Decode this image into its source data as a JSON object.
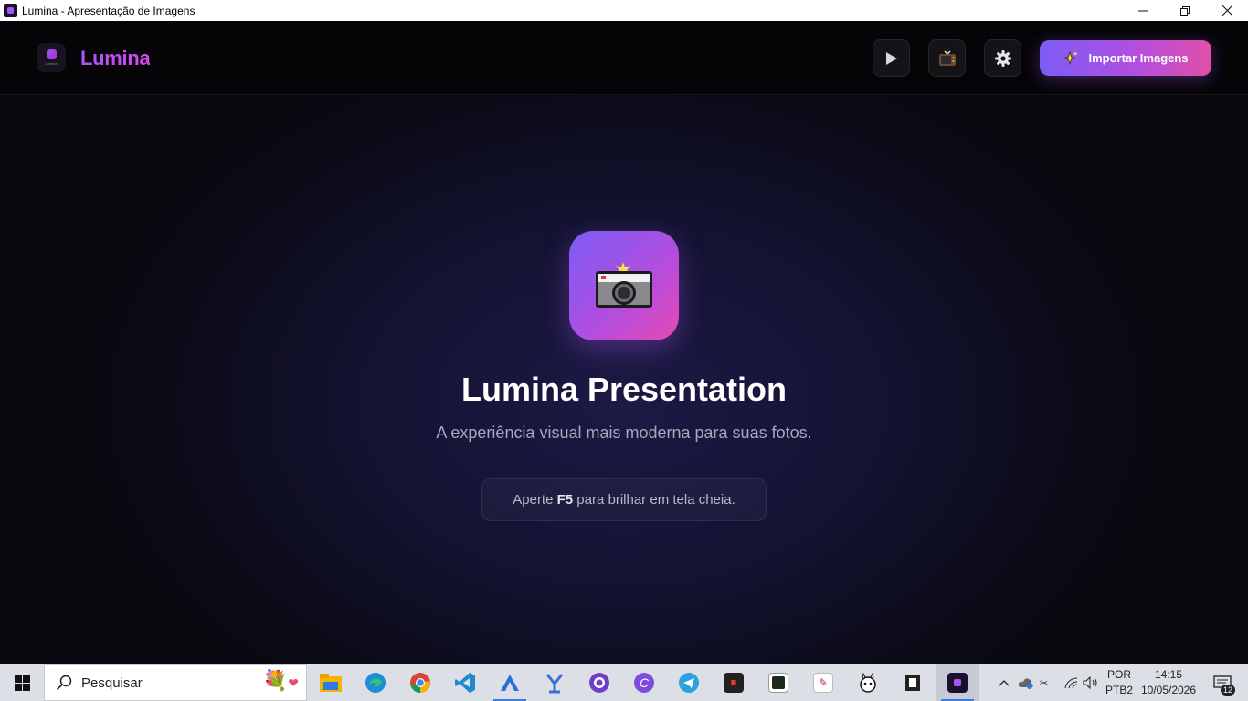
{
  "window": {
    "title": "Lumina - Apresentação de Imagens",
    "controls": {
      "minimize": "—",
      "restore": "❐",
      "close": "✕"
    }
  },
  "header": {
    "brand": "Lumina",
    "logo_caption": "Lumina",
    "buttons": {
      "play_icon": "play-icon",
      "tv_icon": "tv-icon",
      "settings_icon": "gear-icon",
      "import_label": "Importar Imagens",
      "import_icon": "sparkles-icon"
    },
    "accent_colors": [
      "#7c5cf6",
      "#b14fe0",
      "#e14fa8"
    ]
  },
  "hero": {
    "icon": "camera-flash-icon",
    "title": "Lumina Presentation",
    "subtitle": "A experiência visual mais moderna para suas fotos.",
    "hint_prefix": "Aperte ",
    "hint_key": "F5",
    "hint_suffix": " para brilhar em tela cheia."
  },
  "taskbar": {
    "search_placeholder": "Pesquisar",
    "apps": [
      "file-explorer-icon",
      "edge-icon",
      "chrome-icon",
      "vscode-icon",
      "antigravity-icon",
      "vpn-icon",
      "github-desktop-icon",
      "canva-icon",
      "telegram-icon",
      "media-app-icon",
      "dashboard-app-icon",
      "pencil-app-icon",
      "alpaca-app-icon",
      "box-app-icon",
      "lumina-app-icon"
    ],
    "tray": {
      "language": "POR",
      "keyboard": "PTB2",
      "time": "14:15",
      "date": "10/05/2026",
      "notifications": "12"
    }
  }
}
